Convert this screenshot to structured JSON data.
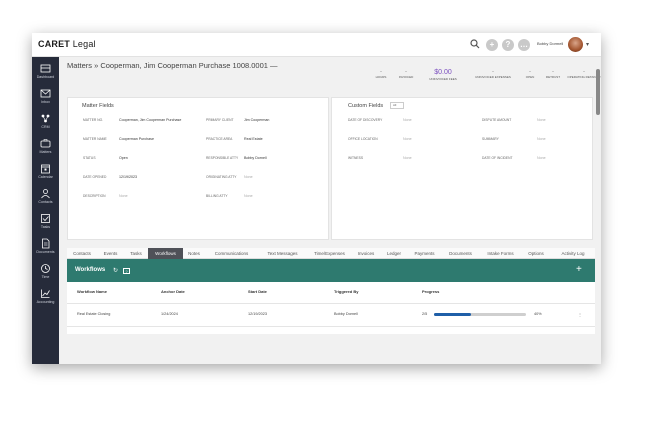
{
  "app": {
    "name_bold": "CARET",
    "name_light": " Legal"
  },
  "topbar": {
    "user_name": "Bobby Dormell",
    "plus": "+",
    "help": "?",
    "chat": "…"
  },
  "sidebar": {
    "items": [
      {
        "label": "Dashboard"
      },
      {
        "label": "Inbox"
      },
      {
        "label": "CRM"
      },
      {
        "label": "Matters"
      },
      {
        "label": "Calendar"
      },
      {
        "label": "Contacts"
      },
      {
        "label": "Tasks"
      },
      {
        "label": "Documents"
      },
      {
        "label": "Time"
      },
      {
        "label": "Accounting"
      }
    ]
  },
  "breadcrumb": "Matters » Cooperman, Jim Cooperman Purchase 1008.0001 —",
  "stats": [
    {
      "value": "-",
      "label": "HOURS"
    },
    {
      "value": "-",
      "label": "INVOICED"
    },
    {
      "value": "$0.00",
      "label": "UNINVOICED FEES"
    },
    {
      "value": "-",
      "label": "UNINVOICED EXPENSES"
    },
    {
      "value": "-",
      "label": "OPEN"
    },
    {
      "value": "-",
      "label": "RETRUST"
    },
    {
      "value": "-",
      "label": "OPERATING RETAINER"
    }
  ],
  "matter_fields": {
    "title": "Matter Fields",
    "rows": [
      {
        "l1": "MATTER NO.",
        "v1": "Cooperman, Jim Cooperman Purchase",
        "l2": "PRIMARY CLIENT",
        "v2": "Jim Cooperman"
      },
      {
        "l1": "MATTER NAME",
        "v1": "Cooperman Purchase",
        "l2": "PRACTICE AREA",
        "v2": "Real Estate"
      },
      {
        "l1": "STATUS",
        "v1": "Open",
        "l2": "RESPONSIBLE ATTY",
        "v2": "Bobby Dornell"
      },
      {
        "l1": "DATE OPENED",
        "v1": "12/19/2023",
        "l2": "ORIGINATING ATTY",
        "v2": "None"
      },
      {
        "l1": "DESCRIPTION",
        "v1": "None",
        "l2": "BILLING ATTY",
        "v2": "None"
      }
    ]
  },
  "custom_fields": {
    "title": "Custom Fields",
    "select": "All",
    "rows": [
      {
        "l1": "DATE OF DISCOVERY",
        "v1": "None",
        "l2": "DISPUTE AMOUNT",
        "v2": "None"
      },
      {
        "l1": "OFFICE LOCATION",
        "v1": "None",
        "l2": "SUMMARY",
        "v2": "None"
      },
      {
        "l1": "WITNESS",
        "v1": "None",
        "l2": "DATE OF INCIDENT",
        "v2": "None"
      }
    ]
  },
  "tabs": [
    "Contacts",
    "Events",
    "Tasks",
    "Workflows",
    "Notes",
    "Communications",
    "Text Messages",
    "Time/Expenses",
    "Invoices",
    "Ledger",
    "Payments",
    "Documents",
    "Intake Forms",
    "Options",
    "Activity Log"
  ],
  "active_tab": "Workflows",
  "workflows": {
    "title": "Workflows",
    "add": "+",
    "headers": [
      "Workflow Name",
      "Anchor Date",
      "Start Date",
      "Triggered By",
      "Progress"
    ],
    "rows": [
      {
        "name": "Real Estate Closing",
        "anchor": "1/24/2024",
        "start": "12/19/2023",
        "triggered": "Bobby Dornell",
        "progress_text": "2/5",
        "progress_pct": "40%",
        "progress": 0.4,
        "menu": "⋮"
      }
    ]
  },
  "colors": {
    "sidebar": "#262b3a",
    "workflow_header": "#2e7a6f",
    "progress": "#1f5fa8",
    "accent": "#7b4fbf"
  }
}
